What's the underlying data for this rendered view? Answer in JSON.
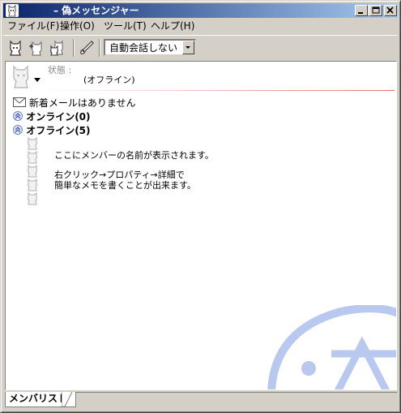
{
  "window": {
    "title": "– 偽メッセンジャー",
    "controls": [
      "minimize",
      "maximize",
      "close"
    ]
  },
  "menu": [
    {
      "label": "ファイル(F)"
    },
    {
      "label": "操作(O)"
    },
    {
      "label": "ツール(T)"
    },
    {
      "label": "ヘルプ(H)"
    }
  ],
  "toolbar": {
    "buttons": [
      "buddy-icon",
      "add-buddy-icon",
      "buddy-group-icon",
      "guitar-icon"
    ],
    "combo_value": "自動会話しない"
  },
  "status": {
    "label": "状態 :",
    "value": "(オフライン)"
  },
  "mail_notice": "新着メールはありません",
  "groups": {
    "online": "オンライン(0)",
    "offline": "オフライン(5)"
  },
  "hint": {
    "line1": "ここにメンバーの名前が表示されます。",
    "line2": "右クリック→プロパティ→詳細で",
    "line3": "簡単なメモを書くことが出来ます。"
  },
  "tab": {
    "label": "メンバリスト"
  },
  "colors": {
    "title_start": "#0a246a",
    "title_end": "#a6caf0",
    "watermark": "#b8c8ee",
    "window_bg": "#d4d0c8"
  }
}
